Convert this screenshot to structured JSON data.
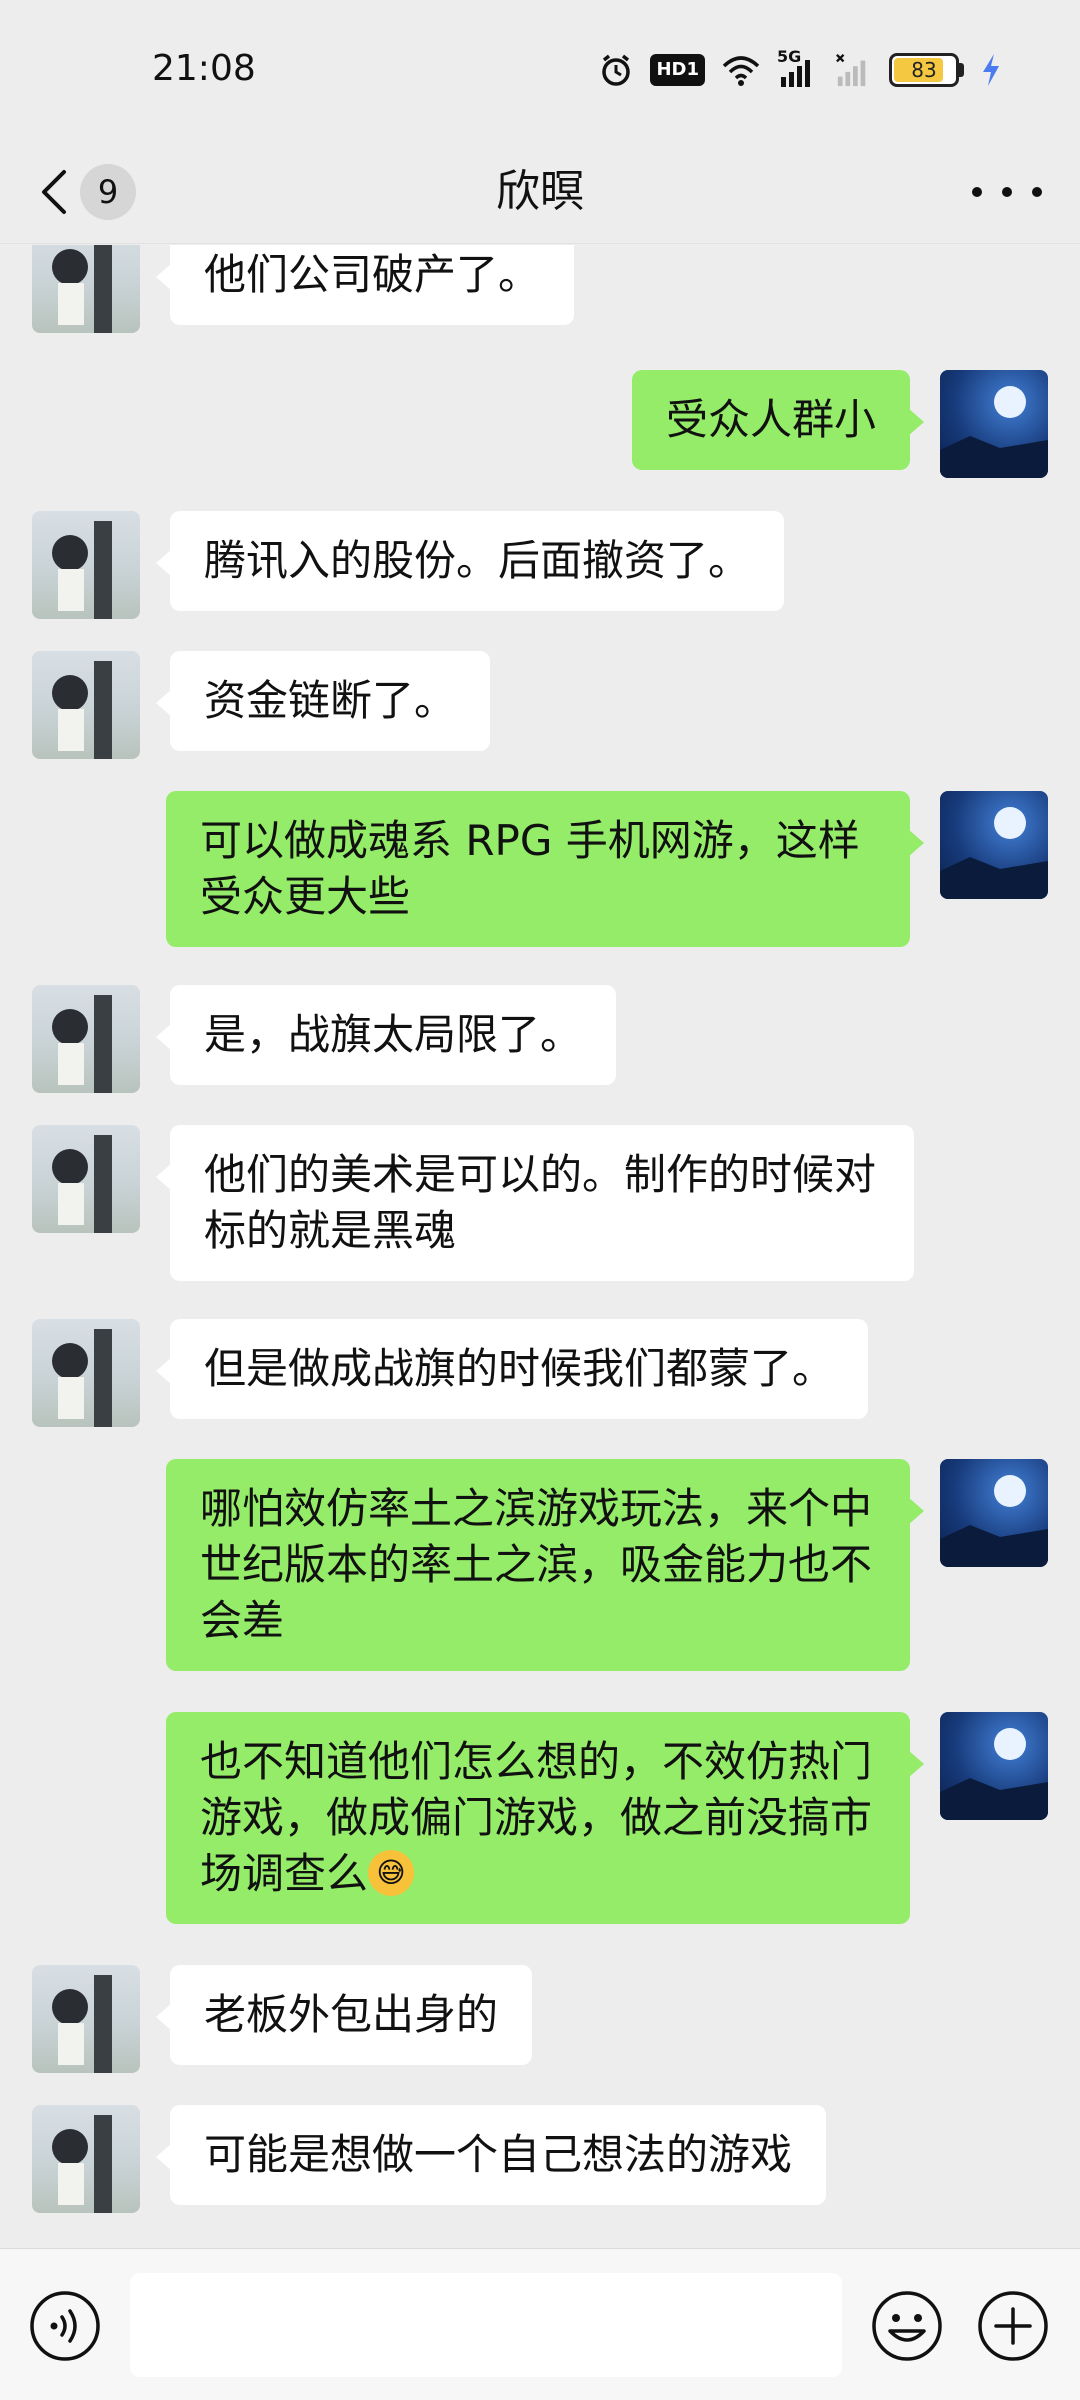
{
  "status_bar": {
    "time": "21:08",
    "hd_label": "HD1",
    "network_label": "5G",
    "battery_level": 83,
    "battery_text": "83",
    "icons": [
      "alarm-icon",
      "hd-icon",
      "wifi-icon",
      "signal-5g-icon",
      "signal-icon",
      "battery-icon",
      "charging-icon"
    ]
  },
  "nav": {
    "unread_count": "9",
    "title": "欣暝",
    "back_icon": "chevron-left-icon",
    "more_icon": "more-dots-icon"
  },
  "messages": [
    {
      "side": "in",
      "text": "他们公司破产了。"
    },
    {
      "side": "out",
      "text": "受众人群小"
    },
    {
      "side": "in",
      "text": "腾讯入的股份。后面撤资了。"
    },
    {
      "side": "in",
      "text": "资金链断了。"
    },
    {
      "side": "out",
      "text": "可以做成魂系 RPG 手机网游，这样受众更大些"
    },
    {
      "side": "in",
      "text": "是，战旗太局限了。"
    },
    {
      "side": "in",
      "text": "他们的美术是可以的。制作的时候对标的就是黑魂"
    },
    {
      "side": "in",
      "text": "但是做成战旗的时候我们都蒙了。"
    },
    {
      "side": "out",
      "text": "哪怕效仿率土之滨游戏玩法，来个中世纪版本的率土之滨，吸金能力也不会差"
    },
    {
      "side": "out",
      "text": "也不知道他们怎么想的，不效仿热门游戏，做成偏门游戏，做之前没搞市场调查么",
      "emoji": "😅"
    },
    {
      "side": "in",
      "text": "老板外包出身的"
    },
    {
      "side": "in",
      "text": "可能是想做一个自己想法的游戏"
    }
  ],
  "input_bar": {
    "value": "",
    "voice_icon": "voice-icon",
    "emoji_icon": "emoji-icon",
    "plus_icon": "plus-icon"
  },
  "colors": {
    "background": "#ededed",
    "outgoing_bubble": "#95ec69",
    "incoming_bubble": "#ffffff"
  }
}
